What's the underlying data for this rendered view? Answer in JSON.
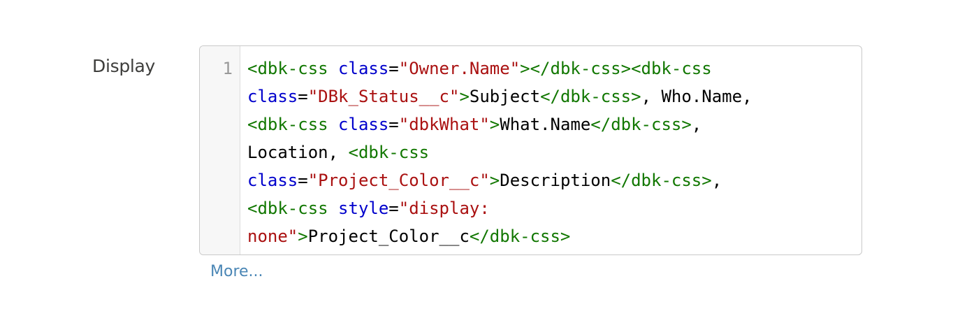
{
  "field": {
    "label": "Display",
    "more_link": "More..."
  },
  "editor": {
    "line_number": "1",
    "lines": [
      [
        {
          "t": "tag",
          "v": "<dbk-css "
        },
        {
          "t": "attr",
          "v": "class"
        },
        {
          "t": "txt",
          "v": "="
        },
        {
          "t": "str",
          "v": "\"Owner.Name\""
        },
        {
          "t": "tag",
          "v": "></dbk-css><dbk-css"
        }
      ],
      [
        {
          "t": "attr",
          "v": "class"
        },
        {
          "t": "txt",
          "v": "="
        },
        {
          "t": "str",
          "v": "\"DBk_Status__c\""
        },
        {
          "t": "tag",
          "v": ">"
        },
        {
          "t": "txt",
          "v": "Subject"
        },
        {
          "t": "tag",
          "v": "</dbk-css>"
        },
        {
          "t": "txt",
          "v": ", Who.Name,"
        }
      ],
      [
        {
          "t": "tag",
          "v": "<dbk-css "
        },
        {
          "t": "attr",
          "v": "class"
        },
        {
          "t": "txt",
          "v": "="
        },
        {
          "t": "str",
          "v": "\"dbkWhat\""
        },
        {
          "t": "tag",
          "v": ">"
        },
        {
          "t": "txt",
          "v": "What.Name"
        },
        {
          "t": "tag",
          "v": "</dbk-css>"
        },
        {
          "t": "txt",
          "v": ","
        }
      ],
      [
        {
          "t": "txt",
          "v": "Location, "
        },
        {
          "t": "tag",
          "v": "<dbk-css"
        }
      ],
      [
        {
          "t": "attr",
          "v": "class"
        },
        {
          "t": "txt",
          "v": "="
        },
        {
          "t": "str",
          "v": "\"Project_Color__c\""
        },
        {
          "t": "tag",
          "v": ">"
        },
        {
          "t": "txt",
          "v": "Description"
        },
        {
          "t": "tag",
          "v": "</dbk-css>"
        },
        {
          "t": "txt",
          "v": ","
        }
      ],
      [
        {
          "t": "tag",
          "v": "<dbk-css "
        },
        {
          "t": "attr",
          "v": "style"
        },
        {
          "t": "txt",
          "v": "="
        },
        {
          "t": "str",
          "v": "\"display:"
        }
      ],
      [
        {
          "t": "str",
          "v": "none\""
        },
        {
          "t": "tag",
          "v": ">"
        },
        {
          "t": "txt",
          "v": "Project_Color__c"
        },
        {
          "t": "tag",
          "v": "</dbk-css>"
        }
      ]
    ]
  },
  "colors": {
    "tag": "#117700",
    "attribute": "#0000cc",
    "string": "#aa1111",
    "text": "#000000",
    "link": "#4a86b5"
  }
}
